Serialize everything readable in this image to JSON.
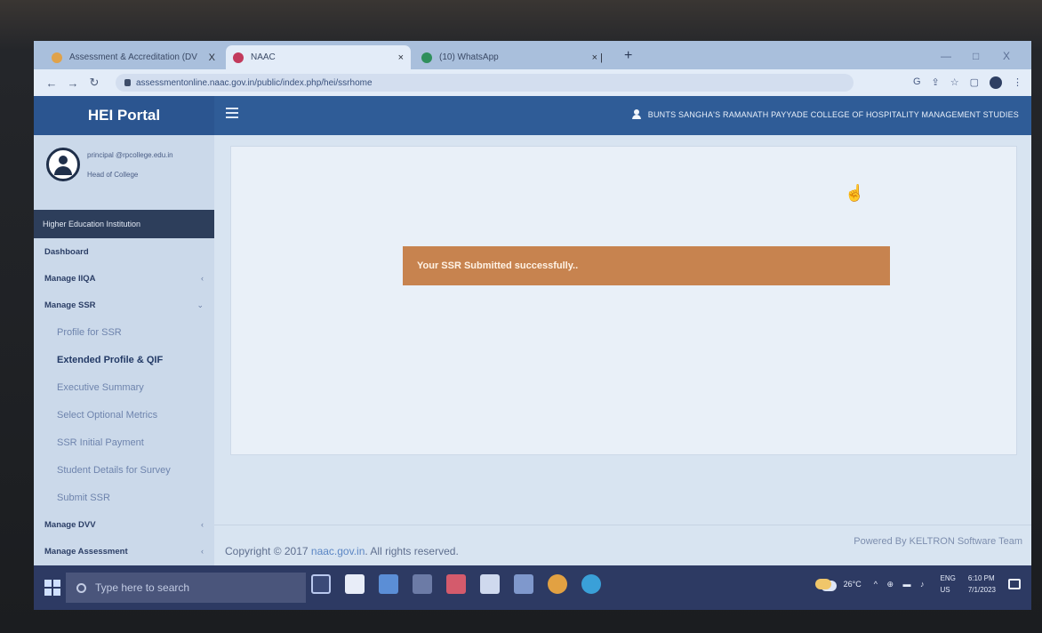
{
  "browser": {
    "tabs": [
      {
        "label": "Assessment & Accreditation (DV",
        "close": "X",
        "favicon_color": "#e0a24a"
      },
      {
        "label": "NAAC",
        "close": "×",
        "favicon_color": "#c23a5c"
      },
      {
        "label": "(10) WhatsApp",
        "close": "× |",
        "favicon_color": "#2f8f5c"
      }
    ],
    "new_tab": "+",
    "url": "assessmentonline.naac.gov.in/public/index.php/hei/ssrhome",
    "window_controls": [
      "—",
      "□",
      "X"
    ]
  },
  "header": {
    "brand": "HEI Portal",
    "college": "BUNTS SANGHA'S RAMANATH PAYYADE COLLEGE OF HOSPITALITY MANAGEMENT STUDIES"
  },
  "sidebar": {
    "profile_name": "principal @rpcollege.edu.in",
    "profile_role": "Head of College",
    "section_title": "Higher Education Institution",
    "menu": [
      {
        "label": "Dashboard",
        "chevron": ""
      },
      {
        "label": "Manage IIQA",
        "chevron": "‹"
      },
      {
        "label": "Manage SSR",
        "chevron": "⌄"
      }
    ],
    "ssr_submenu": [
      "Profile for SSR",
      "Extended Profile & QIF",
      "Executive Summary",
      "Select Optional Metrics",
      "SSR Initial Payment",
      "Student Details for Survey",
      "Submit SSR"
    ],
    "menu_bottom": [
      {
        "label": "Manage DVV",
        "chevron": "‹"
      },
      {
        "label": "Manage Assessment",
        "chevron": "‹"
      }
    ]
  },
  "main": {
    "alert": "Your SSR Submitted successfully..",
    "footer_copyright_prefix": "Copyright © 2017",
    "footer_link": "naac.gov.in",
    "footer_suffix": ". All rights reserved.",
    "powered": "Powered By KELTRON Software Team"
  },
  "taskbar": {
    "search_placeholder": "Type here to search",
    "temperature": "26°C",
    "tray": "^ ⊕ ▬ ♪",
    "lang_top": "ENG",
    "lang_bottom": "US",
    "time": "6:10 PM",
    "date": "7/1/2023"
  }
}
